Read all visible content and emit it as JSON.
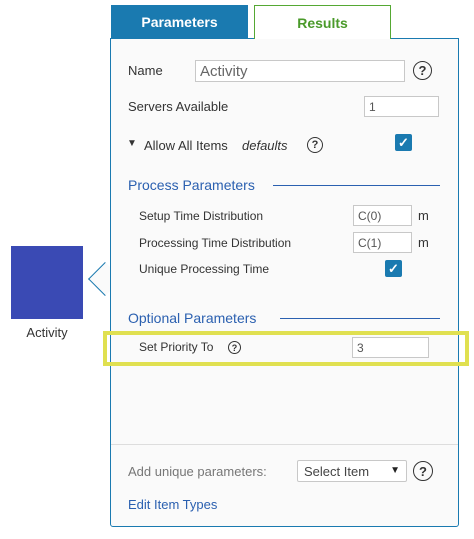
{
  "activity": {
    "label": "Activity",
    "color": "#3a4ab4"
  },
  "tabs": [
    {
      "label": "Parameters",
      "active": true
    },
    {
      "label": "Results",
      "active": false
    }
  ],
  "form": {
    "name_label": "Name",
    "name_value": "Activity",
    "servers_label": "Servers Available",
    "servers_value": "1",
    "allow_all_label": "Allow All Items",
    "allow_all_defaults": "defaults",
    "allow_all_checked": true
  },
  "process_section": {
    "title": "Process Parameters",
    "setup_label": "Setup Time Distribution",
    "setup_value": "C(0)",
    "setup_unit": "m",
    "processing_label": "Processing Time Distribution",
    "processing_value": "C(1)",
    "processing_unit": "m",
    "unique_label": "Unique Processing Time",
    "unique_checked": true
  },
  "optional_section": {
    "title": "Optional Parameters",
    "priority_label": "Set Priority To",
    "priority_value": "3"
  },
  "footer": {
    "add_unique_label": "Add unique parameters:",
    "select_value": "Select Item",
    "edit_link": "Edit Item Types"
  },
  "icons": {
    "help": "?",
    "check": "✓",
    "caret_down": "▼"
  },
  "colors": {
    "accent": "#1a7ab0",
    "section": "#2b60b0",
    "results_tab": "#4a9a2a",
    "highlight": "#e0e050"
  }
}
